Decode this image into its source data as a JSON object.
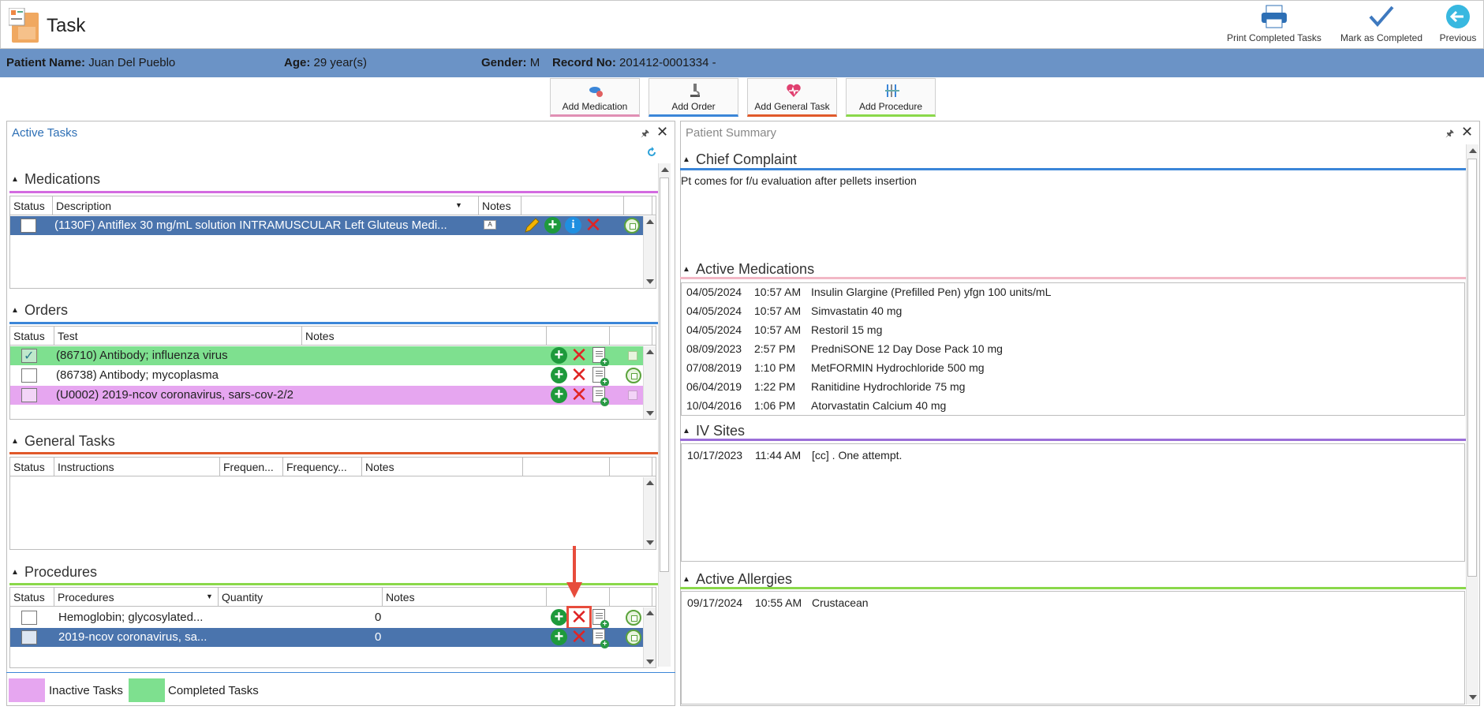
{
  "window": {
    "title": "Task",
    "toolbar": {
      "print_label": "Print Completed Tasks",
      "complete_label": "Mark as Completed",
      "previous_label": "Previous"
    }
  },
  "patient": {
    "name_label": "Patient Name:",
    "name": "Juan Del Pueblo",
    "age_label": "Age:",
    "age": "29 year(s)",
    "gender_label": "Gender:",
    "gender": "M",
    "record_label": "Record No:",
    "record": "201412-0001334 -"
  },
  "actions": {
    "add_medication": "Add Medication",
    "add_order": "Add Order",
    "add_general_task": "Add General Task",
    "add_procedure": "Add Procedure"
  },
  "active_tasks": {
    "title": "Active Tasks",
    "medications": {
      "title": "Medications",
      "headers": [
        "Status",
        "Description",
        "Notes"
      ],
      "rows": [
        {
          "description": "(1130F) Antiflex 30 mg/mL solution INTRAMUSCULAR Left Gluteus Medi..."
        }
      ]
    },
    "orders": {
      "title": "Orders",
      "headers": [
        "Status",
        "Test",
        "Notes"
      ],
      "rows": [
        {
          "test": "(86710) Antibody; influenza virus",
          "state": "completed"
        },
        {
          "test": "(86738) Antibody; mycoplasma",
          "state": "active"
        },
        {
          "test": "(U0002) 2019-ncov coronavirus, sars-cov-2/2",
          "state": "inactive"
        }
      ]
    },
    "general_tasks": {
      "title": "General Tasks",
      "headers": [
        "Status",
        "Instructions",
        "Frequen...",
        "Frequency...",
        "Notes"
      ]
    },
    "procedures": {
      "title": "Procedures",
      "headers": [
        "Status",
        "Procedures",
        "Quantity",
        "Notes"
      ],
      "rows": [
        {
          "procedure": "Hemoglobin; glycosylated...",
          "quantity": "0"
        },
        {
          "procedure": "2019-ncov coronavirus, sa...",
          "quantity": "0"
        }
      ]
    },
    "legend": {
      "inactive": "Inactive Tasks",
      "completed": "Completed Tasks"
    }
  },
  "patient_summary": {
    "title": "Patient Summary",
    "chief_complaint": {
      "title": "Chief Complaint",
      "text": "Pt comes for f/u evaluation after pellets insertion"
    },
    "active_medications": {
      "title": "Active Medications",
      "rows": [
        {
          "date": "04/05/2024",
          "time": "10:57 AM",
          "name": "Insulin Glargine (Prefilled Pen)",
          "dose": "yfgn 100 units/mL"
        },
        {
          "date": "04/05/2024",
          "time": "10:57 AM",
          "name": "Simvastatin",
          "dose": "40 mg"
        },
        {
          "date": "04/05/2024",
          "time": "10:57 AM",
          "name": "Restoril",
          "dose": "15 mg"
        },
        {
          "date": "08/09/2023",
          "time": "2:57 PM",
          "name": "PredniSONE 12 Day Dose Pack",
          "dose": "10 mg"
        },
        {
          "date": "07/08/2019",
          "time": "1:10 PM",
          "name": "MetFORMIN Hydrochloride",
          "dose": "500 mg"
        },
        {
          "date": "06/04/2019",
          "time": "1:22 PM",
          "name": "Ranitidine Hydrochloride",
          "dose": "75 mg"
        },
        {
          "date": "10/04/2016",
          "time": "1:06 PM",
          "name": "Atorvastatin Calcium",
          "dose": "40 mg"
        }
      ]
    },
    "iv_sites": {
      "title": "IV Sites",
      "rows": [
        {
          "date": "10/17/2023",
          "time": "11:44 AM",
          "text": "[cc] . One attempt."
        }
      ]
    },
    "active_allergies": {
      "title": "Active Allergies",
      "rows": [
        {
          "date": "09/17/2024",
          "time": "10:55 AM",
          "text": "Crustacean"
        }
      ]
    }
  },
  "colors": {
    "patient_bar": "#6b93c6",
    "selected_row": "#4a74ad",
    "completed": "#7ee08f",
    "inactive": "#e6a6f0",
    "medications_line": "#d36be0",
    "orders_line": "#3b86d8",
    "general_tasks_line": "#e0592a",
    "procedures_line": "#8ad84a",
    "highlight_arrow": "#e74c3c"
  }
}
